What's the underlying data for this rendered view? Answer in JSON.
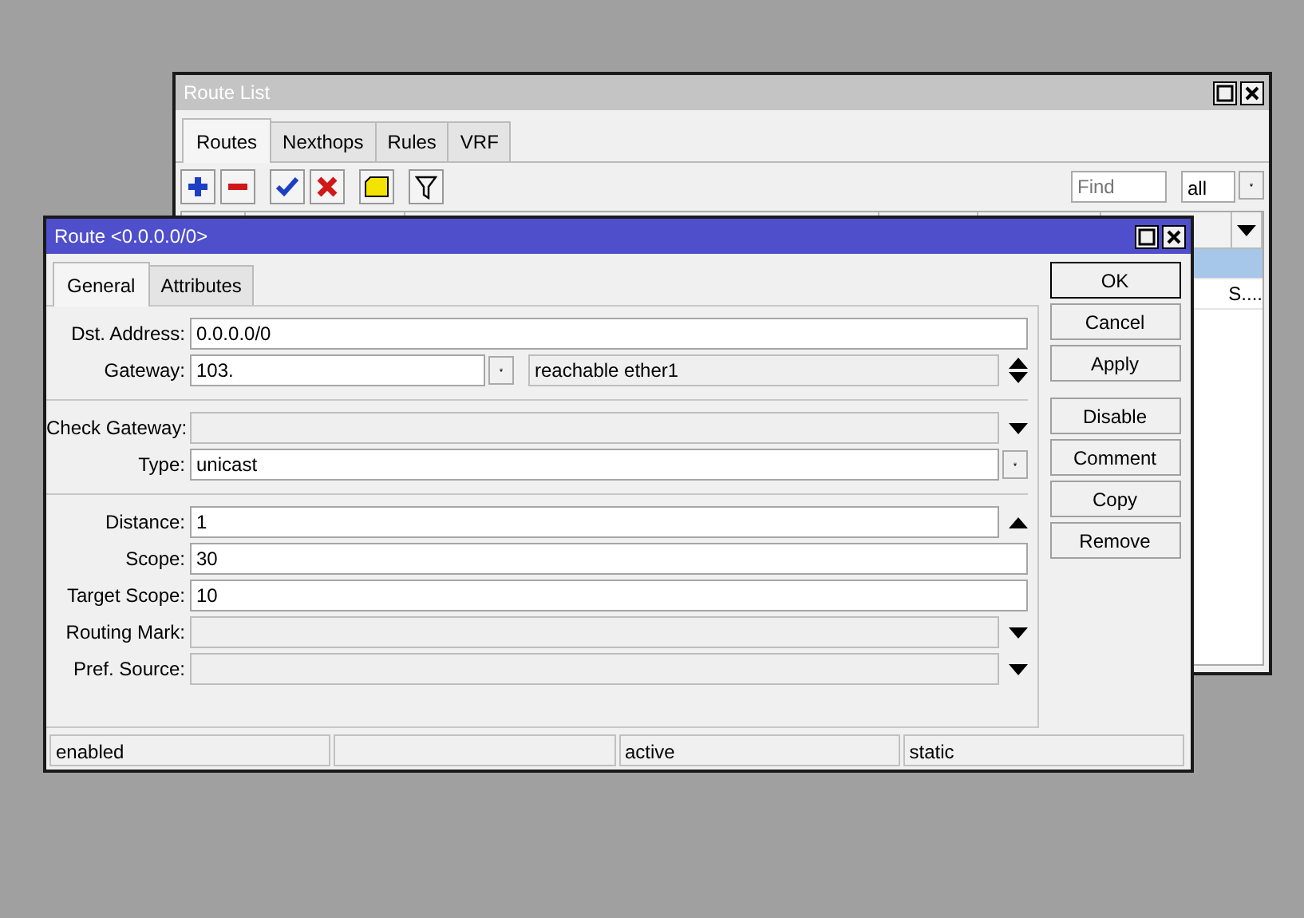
{
  "route_list": {
    "title": "Route List",
    "tabs": [
      {
        "label": "Routes",
        "selected": true
      },
      {
        "label": "Nexthops",
        "selected": false
      },
      {
        "label": "Rules",
        "selected": false
      },
      {
        "label": "VRF",
        "selected": false
      }
    ],
    "find": {
      "placeholder": "Find"
    },
    "filter": "all",
    "rows": [
      {
        "selected": true
      },
      {
        "selected": false,
        "pref_source": "S...."
      }
    ]
  },
  "route_dialog": {
    "title": "Route <0.0.0.0/0>",
    "tabs": [
      {
        "label": "General",
        "selected": true
      },
      {
        "label": "Attributes",
        "selected": false
      }
    ],
    "field_groups": [
      [
        {
          "label": "Dst. Address:",
          "value": "0.0.0.0/0",
          "kind": "plain",
          "disabled": false
        },
        {
          "label": "Gateway:",
          "value": "103.",
          "kind": "gateway",
          "disabled": false,
          "status": "reachable ether1"
        }
      ],
      [
        {
          "label": "Check Gateway:",
          "kind": "down",
          "disabled": true
        },
        {
          "label": "Type:",
          "value": "unicast",
          "kind": "select",
          "disabled": false
        }
      ],
      [
        {
          "label": "Distance:",
          "value": "1",
          "kind": "up",
          "disabled": false
        },
        {
          "label": "Scope:",
          "value": "30",
          "kind": "plain",
          "disabled": false
        },
        {
          "label": "Target Scope:",
          "value": "10",
          "kind": "plain",
          "disabled": false
        },
        {
          "label": "Routing Mark:",
          "kind": "down",
          "disabled": true
        },
        {
          "label": "Pref. Source:",
          "kind": "down",
          "disabled": true
        }
      ]
    ],
    "buttons": [
      {
        "label": "OK",
        "default": true
      },
      {
        "label": "Cancel",
        "default": false
      },
      {
        "label": "Apply",
        "default": false
      },
      {
        "label": "Disable",
        "default": false
      },
      {
        "label": "Comment",
        "default": false
      },
      {
        "label": "Copy",
        "default": false
      },
      {
        "label": "Remove",
        "default": false
      }
    ],
    "status_bar": [
      {
        "kind": "text",
        "text": "enabled"
      },
      {
        "kind": "blank"
      },
      {
        "kind": "text",
        "text": "active"
      },
      {
        "kind": "text",
        "text": "static"
      }
    ]
  }
}
